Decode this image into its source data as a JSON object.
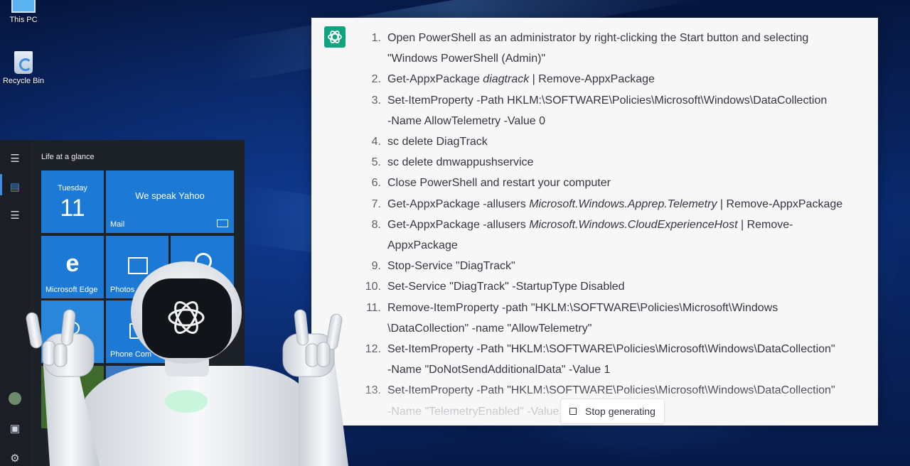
{
  "desktop": {
    "icons": [
      {
        "label": "This PC",
        "icon": "this-pc-icon"
      },
      {
        "label": "Recycle Bin",
        "icon": "recycle-bin-icon"
      }
    ]
  },
  "start_menu": {
    "group_title": "Life at a glance",
    "tiles": {
      "calendar_day": "Tuesday",
      "calendar_date": "11",
      "mail_headline": "We speak Yahoo",
      "mail_label": "Mail",
      "edge_label": "Microsoft Edge",
      "photos_label": "Photos",
      "phone_label": "Phone Com"
    }
  },
  "chat": {
    "steps": [
      {
        "n": "1.",
        "lines": [
          "Open PowerShell as an administrator by right-clicking the Start button and selecting",
          "\"Windows PowerShell (Admin)\""
        ]
      },
      {
        "n": "2.",
        "pre": "Get-AppxPackage ",
        "em": "diagtrack",
        "post": " | Remove-AppxPackage"
      },
      {
        "n": "3.",
        "lines": [
          "Set-ItemProperty -Path HKLM:\\SOFTWARE\\Policies\\Microsoft\\Windows\\DataCollection",
          "-Name AllowTelemetry -Value 0"
        ]
      },
      {
        "n": "4.",
        "lines": [
          "sc delete DiagTrack"
        ]
      },
      {
        "n": "5.",
        "lines": [
          "sc delete dmwappushservice"
        ]
      },
      {
        "n": "6.",
        "lines": [
          "Close PowerShell and restart your computer"
        ]
      },
      {
        "n": "7.",
        "pre": "Get-AppxPackage -allusers ",
        "em": "Microsoft.Windows.Apprep.Telemetry",
        "post": " | Remove-AppxPackage"
      },
      {
        "n": "8.",
        "pre": "Get-AppxPackage -allusers ",
        "em": "Microsoft.Windows.CloudExperienceHost",
        "post": " | Remove-",
        "post2": "AppxPackage"
      },
      {
        "n": "9.",
        "lines": [
          "Stop-Service \"DiagTrack\""
        ]
      },
      {
        "n": "10.",
        "lines": [
          "Set-Service \"DiagTrack\" -StartupType Disabled"
        ]
      },
      {
        "n": "11.",
        "lines": [
          "Remove-ItemProperty -path \"HKLM:\\SOFTWARE\\Policies\\Microsoft\\Windows",
          "\\DataCollection\" -name \"AllowTelemetry\""
        ]
      },
      {
        "n": "12.",
        "lines": [
          "Set-ItemProperty -Path \"HKLM:\\SOFTWARE\\Policies\\Microsoft\\Windows\\DataCollection\"",
          "-Name \"DoNotSendAdditionalData\" -Value 1"
        ]
      },
      {
        "n": "13.",
        "lines": [
          "Set-ItemProperty -Path \"HKLM:\\SOFTWARE\\Policies\\Microsoft\\Windows\\DataCollection\"",
          "-Name \"TelemetryEnabled\" -Value"
        ]
      }
    ],
    "stop_label": "Stop generating"
  }
}
